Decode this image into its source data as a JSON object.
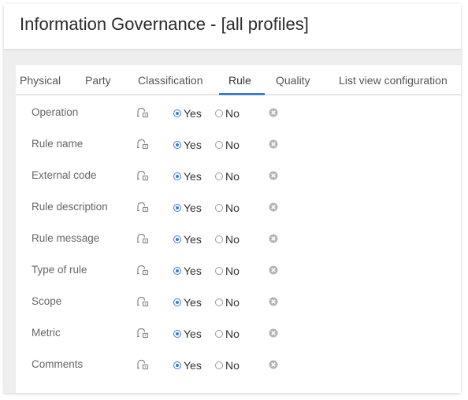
{
  "header": {
    "title": "Information Governance - [all profiles]"
  },
  "tabs": [
    {
      "label": "Physical",
      "active": false
    },
    {
      "label": "Party",
      "active": false
    },
    {
      "label": "Classification",
      "active": false
    },
    {
      "label": "Rule",
      "active": true
    },
    {
      "label": "Quality",
      "active": false
    },
    {
      "label": "List view configuration",
      "active": false
    }
  ],
  "fields": [
    {
      "label": "Operation",
      "value": "Yes"
    },
    {
      "label": "Rule name",
      "value": "Yes"
    },
    {
      "label": "External code",
      "value": "Yes"
    },
    {
      "label": "Rule description",
      "value": "Yes"
    },
    {
      "label": "Rule message",
      "value": "Yes"
    },
    {
      "label": "Type of rule",
      "value": "Yes"
    },
    {
      "label": "Scope",
      "value": "Yes"
    },
    {
      "label": "Metric",
      "value": "Yes"
    },
    {
      "label": "Comments",
      "value": "Yes"
    }
  ],
  "options": {
    "yes": "Yes",
    "no": "No"
  },
  "icons": {
    "field_lock": "lock-people-icon",
    "clear": "clear-circle-icon"
  },
  "colors": {
    "accent": "#3d7bd9",
    "icon": "#b5b5b5"
  }
}
